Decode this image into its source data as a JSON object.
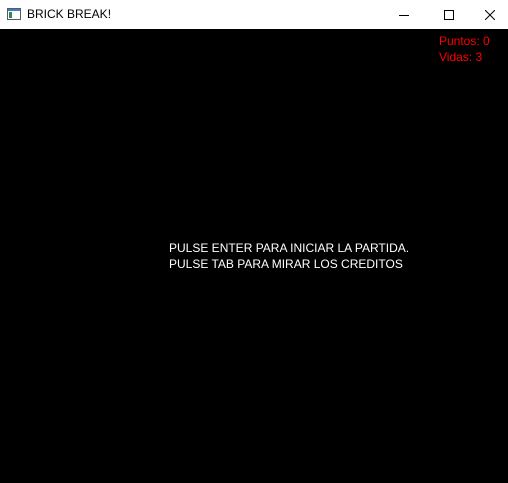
{
  "window": {
    "title": "BRICK BREAK!",
    "buttons": {
      "minimize_icon": "minimize-icon",
      "maximize_icon": "maximize-icon",
      "close_icon": "close-icon"
    }
  },
  "hud": {
    "points_label": "Puntos:",
    "points_value": "0",
    "lives_label": "Vidas:",
    "lives_value": "3",
    "color": "#ff0000"
  },
  "message": {
    "line1": "PULSE ENTER PARA INICIAR LA PARTIDA.",
    "line2": "PULSE TAB PARA MIRAR LOS CREDITOS",
    "color": "#ffffff"
  },
  "colors": {
    "background": "#000000",
    "titlebar": "#ffffff"
  }
}
